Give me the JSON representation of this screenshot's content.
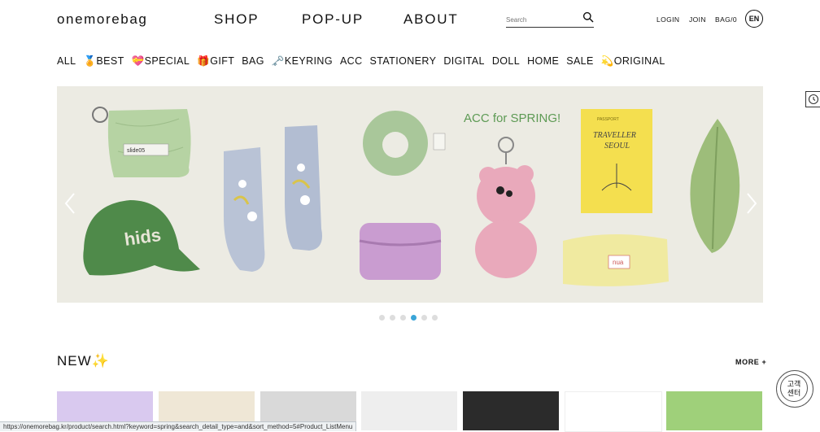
{
  "brand": {
    "logo": "onemorebag"
  },
  "mainnav": {
    "items": [
      {
        "label": "SHOP"
      },
      {
        "label": "POP-UP"
      },
      {
        "label": "ABOUT"
      }
    ]
  },
  "search": {
    "placeholder": "Search",
    "icon": "search-icon"
  },
  "toplinks": {
    "login": "LOGIN",
    "join": "JOIN",
    "bag": "BAG/0",
    "lang": "EN"
  },
  "categories": [
    {
      "icon": "🏅",
      "label": "BEST"
    },
    {
      "icon": "💝",
      "label": "SPECIAL"
    },
    {
      "icon": "🎁",
      "label": "GIFT"
    },
    {
      "icon": "",
      "label": "BAG"
    },
    {
      "icon": "🗝️",
      "label": "KEYRING"
    },
    {
      "icon": "",
      "label": "ACC"
    },
    {
      "icon": "",
      "label": "STATIONERY"
    },
    {
      "icon": "",
      "label": "DIGITAL"
    },
    {
      "icon": "",
      "label": "DOLL"
    },
    {
      "icon": "",
      "label": "HOME"
    },
    {
      "icon": "",
      "label": "SALE"
    },
    {
      "icon": "💫",
      "label": "ORIGINAL"
    }
  ],
  "banner": {
    "headline": "ACC for SPRING!",
    "tag_label": "slide05",
    "cap_text": "hids",
    "book_small": "PASSPORT",
    "book_title_1": "TRAVELLER",
    "book_title_2": "SEOUL",
    "pouch_label": "nua",
    "slide_count": 6,
    "active_slide": 4,
    "colors": {
      "background": "#ecebe3",
      "green": "#4f8a4a",
      "sage": "#a9c79a",
      "pink": "#e9a9bb",
      "yellow": "#f4df4f"
    }
  },
  "new_section": {
    "title": "NEW✨",
    "more": "MORE +"
  },
  "products": [
    {
      "name": "product-1",
      "color": "#d9c9ef"
    },
    {
      "name": "product-2",
      "color": "#efe7d6"
    },
    {
      "name": "product-3",
      "color": "#d9d9d9"
    },
    {
      "name": "product-4",
      "color": "#eeeeee"
    },
    {
      "name": "product-5",
      "color": "#2b2b2b"
    },
    {
      "name": "product-6",
      "color": "#ffffff"
    },
    {
      "name": "product-7",
      "color": "#9fd07a"
    }
  ],
  "status_url": "https://onemorebag.kr/product/search.html?keyword=spring&search_detail_type=and&sort_method=5#Product_ListMenu",
  "customer_center": {
    "line1": "고객",
    "line2": "센터"
  }
}
